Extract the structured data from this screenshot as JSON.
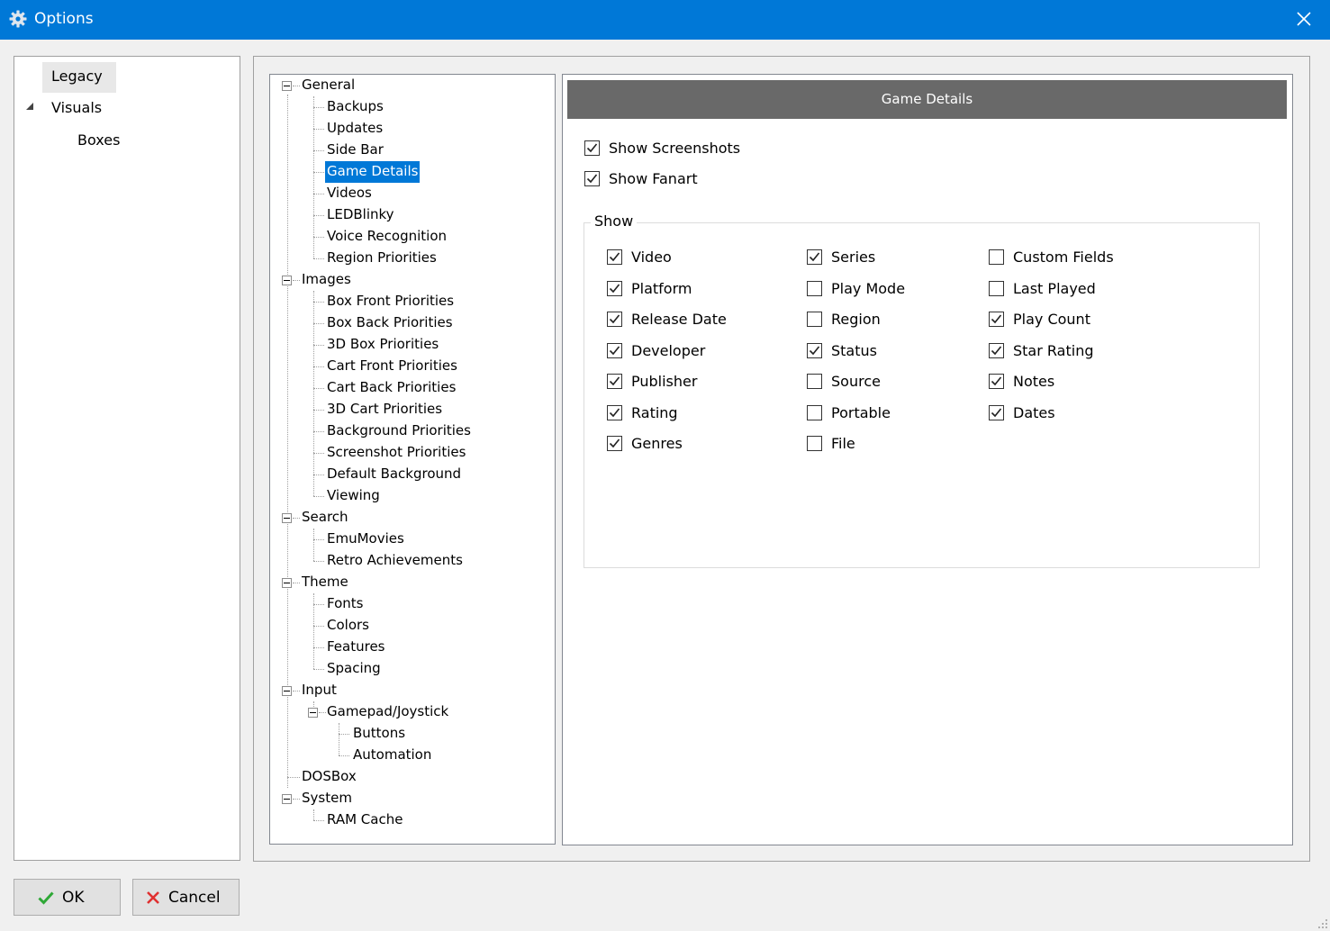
{
  "window": {
    "title": "Options",
    "icon": "gear-icon",
    "close_icon": "close-icon"
  },
  "left_nav": {
    "items": [
      {
        "label": "Legacy",
        "selected": true
      },
      {
        "label": "Visuals",
        "expanded": true,
        "icon": "collapse-triangle-icon"
      },
      {
        "label": "Boxes"
      }
    ]
  },
  "options_tree": {
    "nodes": [
      {
        "label": "General"
      },
      {
        "label": "Backups"
      },
      {
        "label": "Updates"
      },
      {
        "label": "Side Bar"
      },
      {
        "label": "Game Details",
        "selected": true
      },
      {
        "label": "Videos"
      },
      {
        "label": "LEDBlinky"
      },
      {
        "label": "Voice Recognition"
      },
      {
        "label": "Region Priorities"
      },
      {
        "label": "Images"
      },
      {
        "label": "Box Front Priorities"
      },
      {
        "label": "Box Back Priorities"
      },
      {
        "label": "3D Box Priorities"
      },
      {
        "label": "Cart Front Priorities"
      },
      {
        "label": "Cart Back Priorities"
      },
      {
        "label": "3D Cart Priorities"
      },
      {
        "label": "Background Priorities"
      },
      {
        "label": "Screenshot Priorities"
      },
      {
        "label": "Default Background"
      },
      {
        "label": "Viewing"
      },
      {
        "label": "Search"
      },
      {
        "label": "EmuMovies"
      },
      {
        "label": "Retro Achievements"
      },
      {
        "label": "Theme"
      },
      {
        "label": "Fonts"
      },
      {
        "label": "Colors"
      },
      {
        "label": "Features"
      },
      {
        "label": "Spacing"
      },
      {
        "label": "Input"
      },
      {
        "label": "Gamepad/Joystick"
      },
      {
        "label": "Buttons"
      },
      {
        "label": "Automation"
      },
      {
        "label": "DOSBox"
      },
      {
        "label": "System"
      },
      {
        "label": "RAM Cache"
      }
    ]
  },
  "content": {
    "header": "Game Details",
    "top_options": [
      {
        "label": "Show Screenshots",
        "checked": true
      },
      {
        "label": "Show Fanart",
        "checked": true
      }
    ],
    "group": {
      "label": "Show",
      "columns": [
        [
          {
            "label": "Video",
            "checked": true
          },
          {
            "label": "Platform",
            "checked": true
          },
          {
            "label": "Release Date",
            "checked": true
          },
          {
            "label": "Developer",
            "checked": true
          },
          {
            "label": "Publisher",
            "checked": true
          },
          {
            "label": "Rating",
            "checked": true
          },
          {
            "label": "Genres",
            "checked": true
          }
        ],
        [
          {
            "label": "Series",
            "checked": true
          },
          {
            "label": "Play Mode",
            "checked": false
          },
          {
            "label": "Region",
            "checked": false
          },
          {
            "label": "Status",
            "checked": true
          },
          {
            "label": "Source",
            "checked": false
          },
          {
            "label": "Portable",
            "checked": false
          },
          {
            "label": "File",
            "checked": false
          }
        ],
        [
          {
            "label": "Custom Fields",
            "checked": false
          },
          {
            "label": "Last Played",
            "checked": false
          },
          {
            "label": "Play Count",
            "checked": true
          },
          {
            "label": "Star Rating",
            "checked": true
          },
          {
            "label": "Notes",
            "checked": true
          },
          {
            "label": "Dates",
            "checked": true
          }
        ]
      ]
    }
  },
  "buttons": {
    "ok": {
      "label": "OK",
      "icon": "checkmark-icon"
    },
    "cancel": {
      "label": "Cancel",
      "icon": "x-icon"
    }
  },
  "colors": {
    "titlebar": "#0078d7",
    "selection": "#0078d7",
    "header_bg": "#696969",
    "ok_icon": "#2ea836",
    "cancel_icon": "#e03030"
  }
}
